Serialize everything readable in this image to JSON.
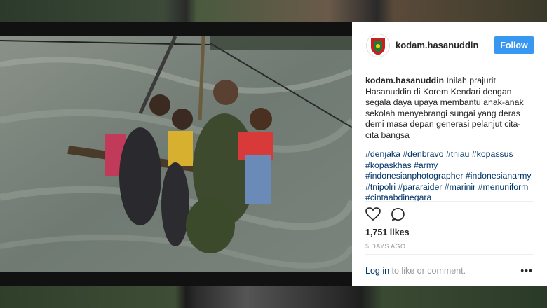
{
  "post": {
    "username": "kodam.hasanuddin",
    "follow_label": "Follow",
    "caption_username": "kodam.hasanuddin",
    "caption_text": "Inilah prajurit Hasanuddin di Korem Kendari dengan segala daya upaya membantu anak-anak sekolah menyebrangi sungai yang deras demi masa depan generasi pelanjut cita-cita bangsa",
    "hashtags": [
      "#denjaka",
      "#denbravo",
      "#tniau",
      "#kopassus",
      "#kopaskhas",
      "#army",
      "#indonesianphotographer",
      "#indonesianarmy",
      "#tnipolri",
      "#pararaider",
      "#marinir",
      "#menuniform",
      "#cintaabdinegara"
    ],
    "likes": "1,751 likes",
    "date": "5 DAYS AGO",
    "login_link": "Log in",
    "login_suffix": " to like or comment.",
    "more_label": "•••"
  },
  "icons": {
    "like": "heart-icon",
    "comment": "comment-icon",
    "avatar": "kodam-emblem-icon"
  },
  "colors": {
    "follow_button": "#3897f0",
    "link": "#003569",
    "muted": "#999999"
  }
}
